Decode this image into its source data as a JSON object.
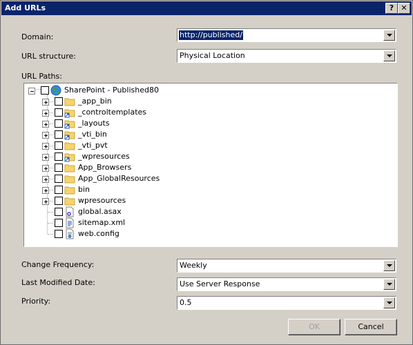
{
  "window": {
    "title": "Add URLs",
    "help_label": "?",
    "close_label": "✕"
  },
  "form": {
    "domain_label": "Domain:",
    "domain_value": "http://published/",
    "url_structure_label": "URL structure:",
    "url_structure_value": "Physical Location",
    "url_paths_label": "URL Paths:",
    "change_frequency_label": "Change Frequency:",
    "change_frequency_value": "Weekly",
    "last_modified_label": "Last Modified Date:",
    "last_modified_value": "Use Server Response",
    "priority_label": "Priority:",
    "priority_value": "0.5"
  },
  "tree": {
    "root": {
      "label": "SharePoint - Published80",
      "icon": "globe-icon"
    },
    "items": [
      {
        "label": "_app_bin",
        "icon": "folder-icon"
      },
      {
        "label": "_controltemplates",
        "icon": "folder-link-icon"
      },
      {
        "label": "_layouts",
        "icon": "folder-link-icon"
      },
      {
        "label": "_vti_bin",
        "icon": "folder-link-icon"
      },
      {
        "label": "_vti_pvt",
        "icon": "folder-icon"
      },
      {
        "label": "_wpresources",
        "icon": "folder-link-icon"
      },
      {
        "label": "App_Browsers",
        "icon": "folder-icon"
      },
      {
        "label": "App_GlobalResources",
        "icon": "folder-icon"
      },
      {
        "label": "bin",
        "icon": "folder-icon"
      },
      {
        "label": "wpresources",
        "icon": "folder-icon"
      },
      {
        "label": "global.asax",
        "icon": "asax-file-icon"
      },
      {
        "label": "sitemap.xml",
        "icon": "xml-file-icon"
      },
      {
        "label": "web.config",
        "icon": "config-file-icon"
      }
    ]
  },
  "buttons": {
    "ok_label": "OK",
    "cancel_label": "Cancel"
  },
  "colors": {
    "titlebar": "#0a246a",
    "dialog_bg": "#d4d0c8",
    "selection": "#0a246a",
    "folder": "#f5d46b"
  }
}
